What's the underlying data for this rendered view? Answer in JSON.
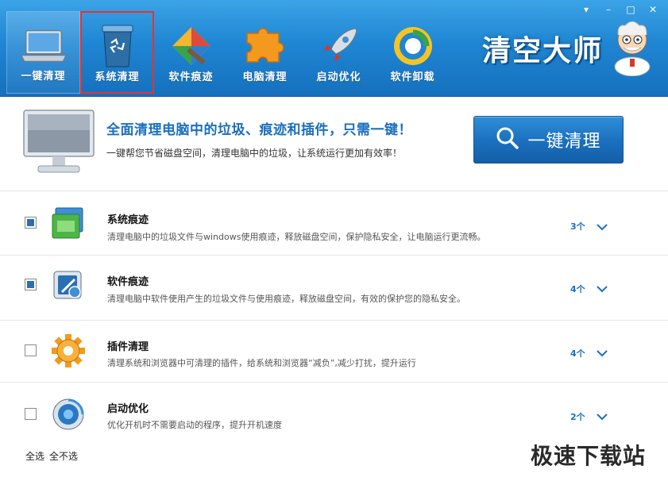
{
  "window_controls": {
    "menu": "▾",
    "minimize": "–",
    "maximize": "□",
    "close": "✕"
  },
  "nav": [
    {
      "label": "一键清理",
      "icon": "laptop-icon"
    },
    {
      "label": "系统清理",
      "icon": "recycle-bin-icon"
    },
    {
      "label": "软件痕迹",
      "icon": "brush-icon"
    },
    {
      "label": "电脑清理",
      "icon": "puzzle-icon"
    },
    {
      "label": "启动优化",
      "icon": "rocket-icon"
    },
    {
      "label": "软件卸载",
      "icon": "uninstall-icon"
    }
  ],
  "brand": {
    "title": "清空大师",
    "mascot": "doctor-mascot-icon"
  },
  "hero": {
    "title": "全面清理电脑中的垃圾、痕迹和插件，只需一键！",
    "subtitle": "一键帮您节省磁盘空间，清理电脑中的垃圾，让系统运行更加有效率！",
    "button_label": "一键清理"
  },
  "items": [
    {
      "title": "系统痕迹",
      "desc": "清理电脑中的垃圾文件与windows使用痕迹，释放磁盘空间，保护隐私安全，让电脑运行更流畅。",
      "count": "3个",
      "checked": true,
      "icon": "system-traces-icon"
    },
    {
      "title": "软件痕迹",
      "desc": "清理电脑中软件使用产生的垃圾文件与使用痕迹，释放磁盘空间，有效的保护您的隐私安全。",
      "count": "4个",
      "checked": true,
      "icon": "software-traces-icon"
    },
    {
      "title": "插件清理",
      "desc": "清理系统和浏览器中可清理的插件，给系统和浏览器“减负”,减少打扰，提升运行",
      "count": "4个",
      "checked": false,
      "icon": "gear-icon"
    },
    {
      "title": "启动优化",
      "desc": "优化开机时不需要启动的程序，提升开机速度",
      "count": "2个",
      "checked": false,
      "icon": "startup-icon"
    }
  ],
  "footer": {
    "select_all": "全选",
    "select_none": "全不选"
  },
  "watermark": "极速下载站",
  "colors": {
    "header": "#1f86d3",
    "accent": "#1a6fbe",
    "highlight": "#e8322e"
  }
}
